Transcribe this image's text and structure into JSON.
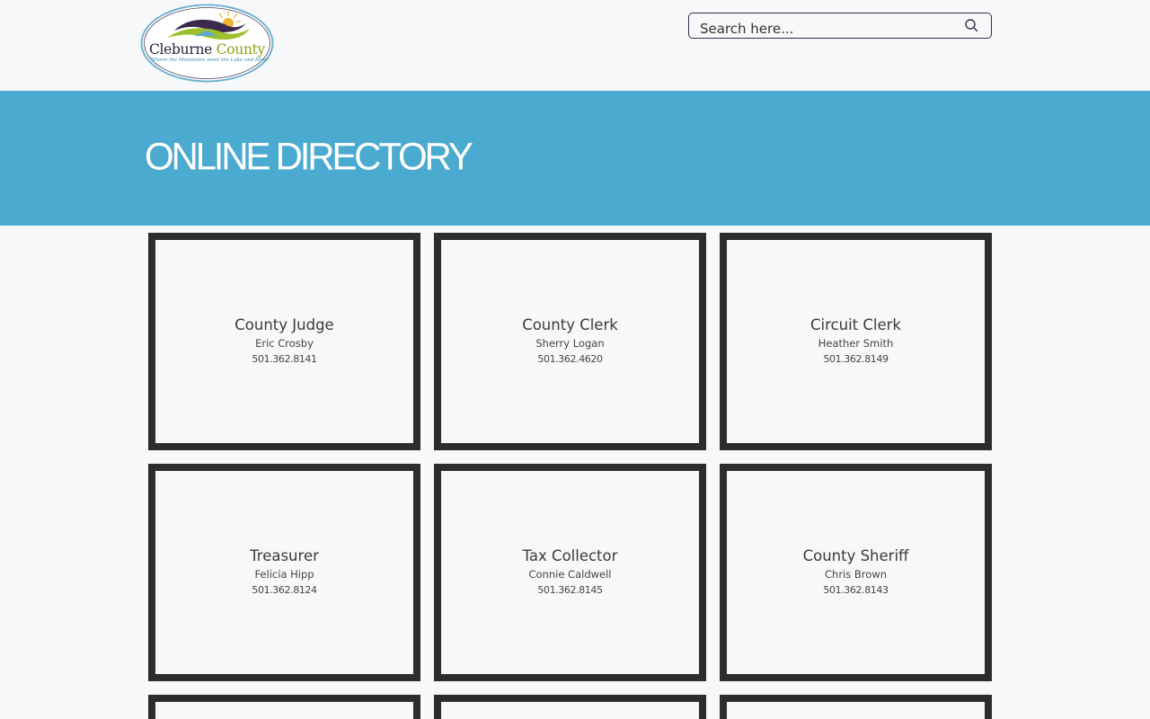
{
  "header": {
    "logo": {
      "name_part1": "Cleburne",
      "name_part2": "County",
      "tagline": "Where the Mountains meet the Lake and River",
      "colors": {
        "purple": "#2a1f3b",
        "green": "#8aa51b",
        "blue": "#3b8fb3",
        "sun": "#f2b233"
      }
    },
    "search": {
      "placeholder": "Search here...",
      "icon": "search-icon"
    }
  },
  "banner": {
    "title": "ONLINE DIRECTORY",
    "color": "#4aaacf"
  },
  "directory": [
    {
      "title": "County Judge",
      "name": "Eric Crosby",
      "phone": "501.362.8141"
    },
    {
      "title": "County Clerk",
      "name": "Sherry Logan",
      "phone": "501.362.4620"
    },
    {
      "title": "Circuit Clerk",
      "name": "Heather Smith",
      "phone": "501.362.8149"
    },
    {
      "title": "Treasurer",
      "name": "Felicia Hipp",
      "phone": "501.362.8124"
    },
    {
      "title": "Tax Collector",
      "name": "Connie Caldwell",
      "phone": "501.362.8145"
    },
    {
      "title": "County Sheriff",
      "name": "Chris Brown",
      "phone": "501.362.8143"
    },
    {
      "title": "",
      "name": "",
      "phone": ""
    },
    {
      "title": "",
      "name": "",
      "phone": ""
    },
    {
      "title": "",
      "name": "",
      "phone": ""
    }
  ]
}
